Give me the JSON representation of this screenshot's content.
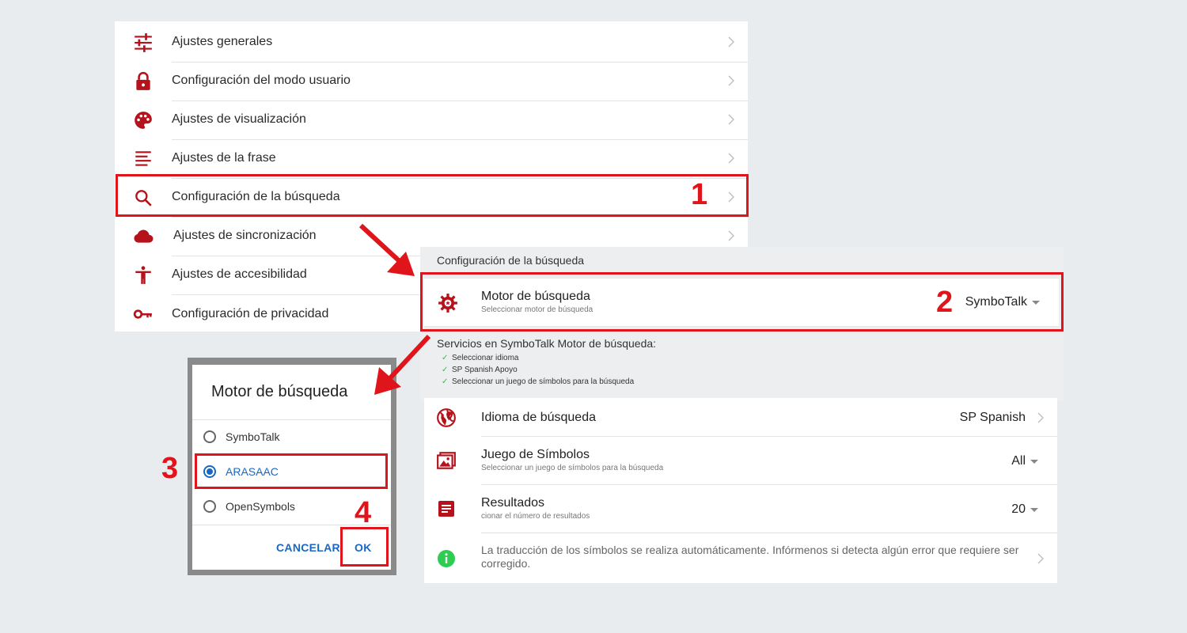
{
  "settings_menu": {
    "items": [
      {
        "label": "Ajustes generales",
        "icon": "sliders-icon"
      },
      {
        "label": "Configuración del modo usuario",
        "icon": "lock-icon"
      },
      {
        "label": "Ajustes de visualización",
        "icon": "palette-icon"
      },
      {
        "label": "Ajustes de la frase",
        "icon": "text-lines-icon"
      },
      {
        "label": "Configuración de la búsqueda",
        "icon": "search-icon"
      },
      {
        "label": "Ajustes de sincronización",
        "icon": "cloud-icon"
      },
      {
        "label": "Ajustes de accesibilidad",
        "icon": "accessibility-icon"
      },
      {
        "label": "Configuración de privacidad",
        "icon": "key-icon"
      }
    ]
  },
  "search_config": {
    "section_title": "Configuración de la búsqueda",
    "engine": {
      "title": "Motor de búsqueda",
      "subtitle": "Seleccionar motor de búsqueda",
      "value": "SymboTalk",
      "icon": "gear-icon"
    },
    "services_title": "Servicios en SymboTalk Motor de búsqueda:",
    "services": [
      "Seleccionar idioma",
      "SP Spanish Apoyo",
      "Seleccionar un juego de símbolos para la búsqueda"
    ],
    "options": {
      "language": {
        "title": "Idioma de búsqueda",
        "value": "SP Spanish",
        "icon": "globe-icon"
      },
      "symbols": {
        "title": "Juego de Símbolos",
        "subtitle": "Seleccionar un juego de símbolos para la búsqueda",
        "value": "All",
        "icon": "images-icon"
      },
      "results": {
        "title": "Resultados",
        "subtitle": "cionar el número de resultados",
        "value": "20",
        "icon": "list-icon"
      },
      "info": {
        "text_line1": "La traducción de los símbolos se realiza automáticamente. Infórmenos si detecta algún error que requiere ser",
        "text_line2": "corregido.",
        "icon": "info-icon"
      }
    }
  },
  "dialog": {
    "title": "Motor de búsqueda",
    "options": [
      {
        "label": "SymboTalk",
        "selected": false
      },
      {
        "label": "ARASAAC",
        "selected": true
      },
      {
        "label": "OpenSymbols",
        "selected": false
      }
    ],
    "cancel_label": "CANCELAR",
    "ok_label": "OK"
  },
  "annotations": {
    "step1": "1",
    "step2": "2",
    "step3": "3",
    "step4": "4",
    "color": "#e0141b"
  },
  "colors": {
    "icon_red": "#b5121b",
    "accent_blue": "#1a67c2",
    "check_green": "#3cba54",
    "info_green": "#2ecc52"
  }
}
